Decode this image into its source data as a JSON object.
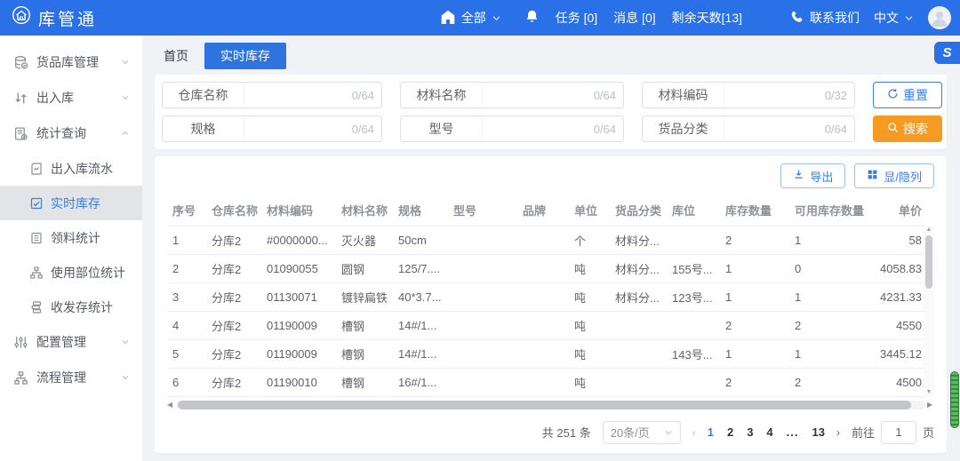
{
  "topbar": {
    "logo_text": "库管通",
    "scope_label": "全部",
    "tasks_label": "任务 [0]",
    "messages_label": "消息 [0]",
    "days_left_label": "剩余天数[13]",
    "contact_label": "联系我们",
    "language_label": "中文"
  },
  "floating_widget_glyph": "S",
  "sidebar": {
    "items": [
      {
        "label": "货品库管理"
      },
      {
        "label": "出入库"
      },
      {
        "label": "统计查询",
        "children": [
          "出入库流水",
          "实时库存",
          "领料统计",
          "使用部位统计",
          "收发存统计"
        ],
        "active_child": "实时库存"
      },
      {
        "label": "配置管理"
      },
      {
        "label": "流程管理"
      }
    ]
  },
  "tabs": {
    "home": "首页",
    "current": "实时库存"
  },
  "search": {
    "fields": [
      {
        "label": "仓库名称",
        "value": "",
        "counter": "0/64"
      },
      {
        "label": "材料名称",
        "value": "",
        "counter": "0/64"
      },
      {
        "label": "材料编码",
        "value": "",
        "counter": "0/32"
      },
      {
        "label": "规格",
        "value": "",
        "counter": "0/64"
      },
      {
        "label": "型号",
        "value": "",
        "counter": "0/64"
      },
      {
        "label": "货品分类",
        "value": "",
        "counter": "0/64"
      }
    ],
    "reset_label": "重置",
    "search_label": "搜索"
  },
  "toolbar": {
    "export_label": "导出",
    "columns_label": "显/隐列"
  },
  "table": {
    "headers": [
      "序号",
      "仓库名称",
      "材料编码",
      "材料名称",
      "规格",
      "型号",
      "品牌",
      "单位",
      "货品分类",
      "库位",
      "库存数量",
      "可用库存数量",
      "单价"
    ],
    "rows": [
      [
        "1",
        "分库2",
        "#0000000...",
        "灭火器",
        "50cm",
        "",
        "",
        "个",
        "材料分...",
        "",
        "2",
        "1",
        "58"
      ],
      [
        "2",
        "分库2",
        "01090055",
        "圆钢",
        "125/7....",
        "",
        "",
        "吨",
        "材料分...",
        "155号...",
        "1",
        "0",
        "4058.83"
      ],
      [
        "3",
        "分库2",
        "01130071",
        "镀锌扁铁",
        "40*3.7...",
        "",
        "",
        "吨",
        "材料分...",
        "123号...",
        "1",
        "1",
        "4231.33"
      ],
      [
        "4",
        "分库2",
        "01190009",
        "槽钢",
        "14#/1...",
        "",
        "",
        "吨",
        "",
        "",
        "2",
        "2",
        "4550"
      ],
      [
        "5",
        "分库2",
        "01190009",
        "槽钢",
        "14#/1...",
        "",
        "",
        "吨",
        "",
        "143号...",
        "1",
        "1",
        "3445.12"
      ],
      [
        "6",
        "分库2",
        "01190010",
        "槽钢",
        "16#/1...",
        "",
        "",
        "吨",
        "",
        "",
        "2",
        "2",
        "4500"
      ]
    ]
  },
  "pagination": {
    "total_label": "共 251 条",
    "page_size_label": "20条/页",
    "pages": [
      "1",
      "2",
      "3",
      "4",
      "...",
      "13"
    ],
    "active_page": "1",
    "prev_label": "‹",
    "next_label": "›",
    "goto_label": "前往",
    "goto_value": "1",
    "goto_suffix_label": "页"
  },
  "colors": {
    "topbar_blue": "#2a70e6",
    "active_tab_blue": "#2f73df",
    "accent_blue": "#3d7de0",
    "search_orange": "#f59a23",
    "scrollbar_green": "#43a047",
    "page_background": "#f0f2f5"
  },
  "icons": {
    "logo": "house-in-circle",
    "scope": "home",
    "notifications": "bell",
    "contact": "phone",
    "reset": "refresh",
    "search": "magnifier",
    "export": "download",
    "columns": "grid"
  }
}
